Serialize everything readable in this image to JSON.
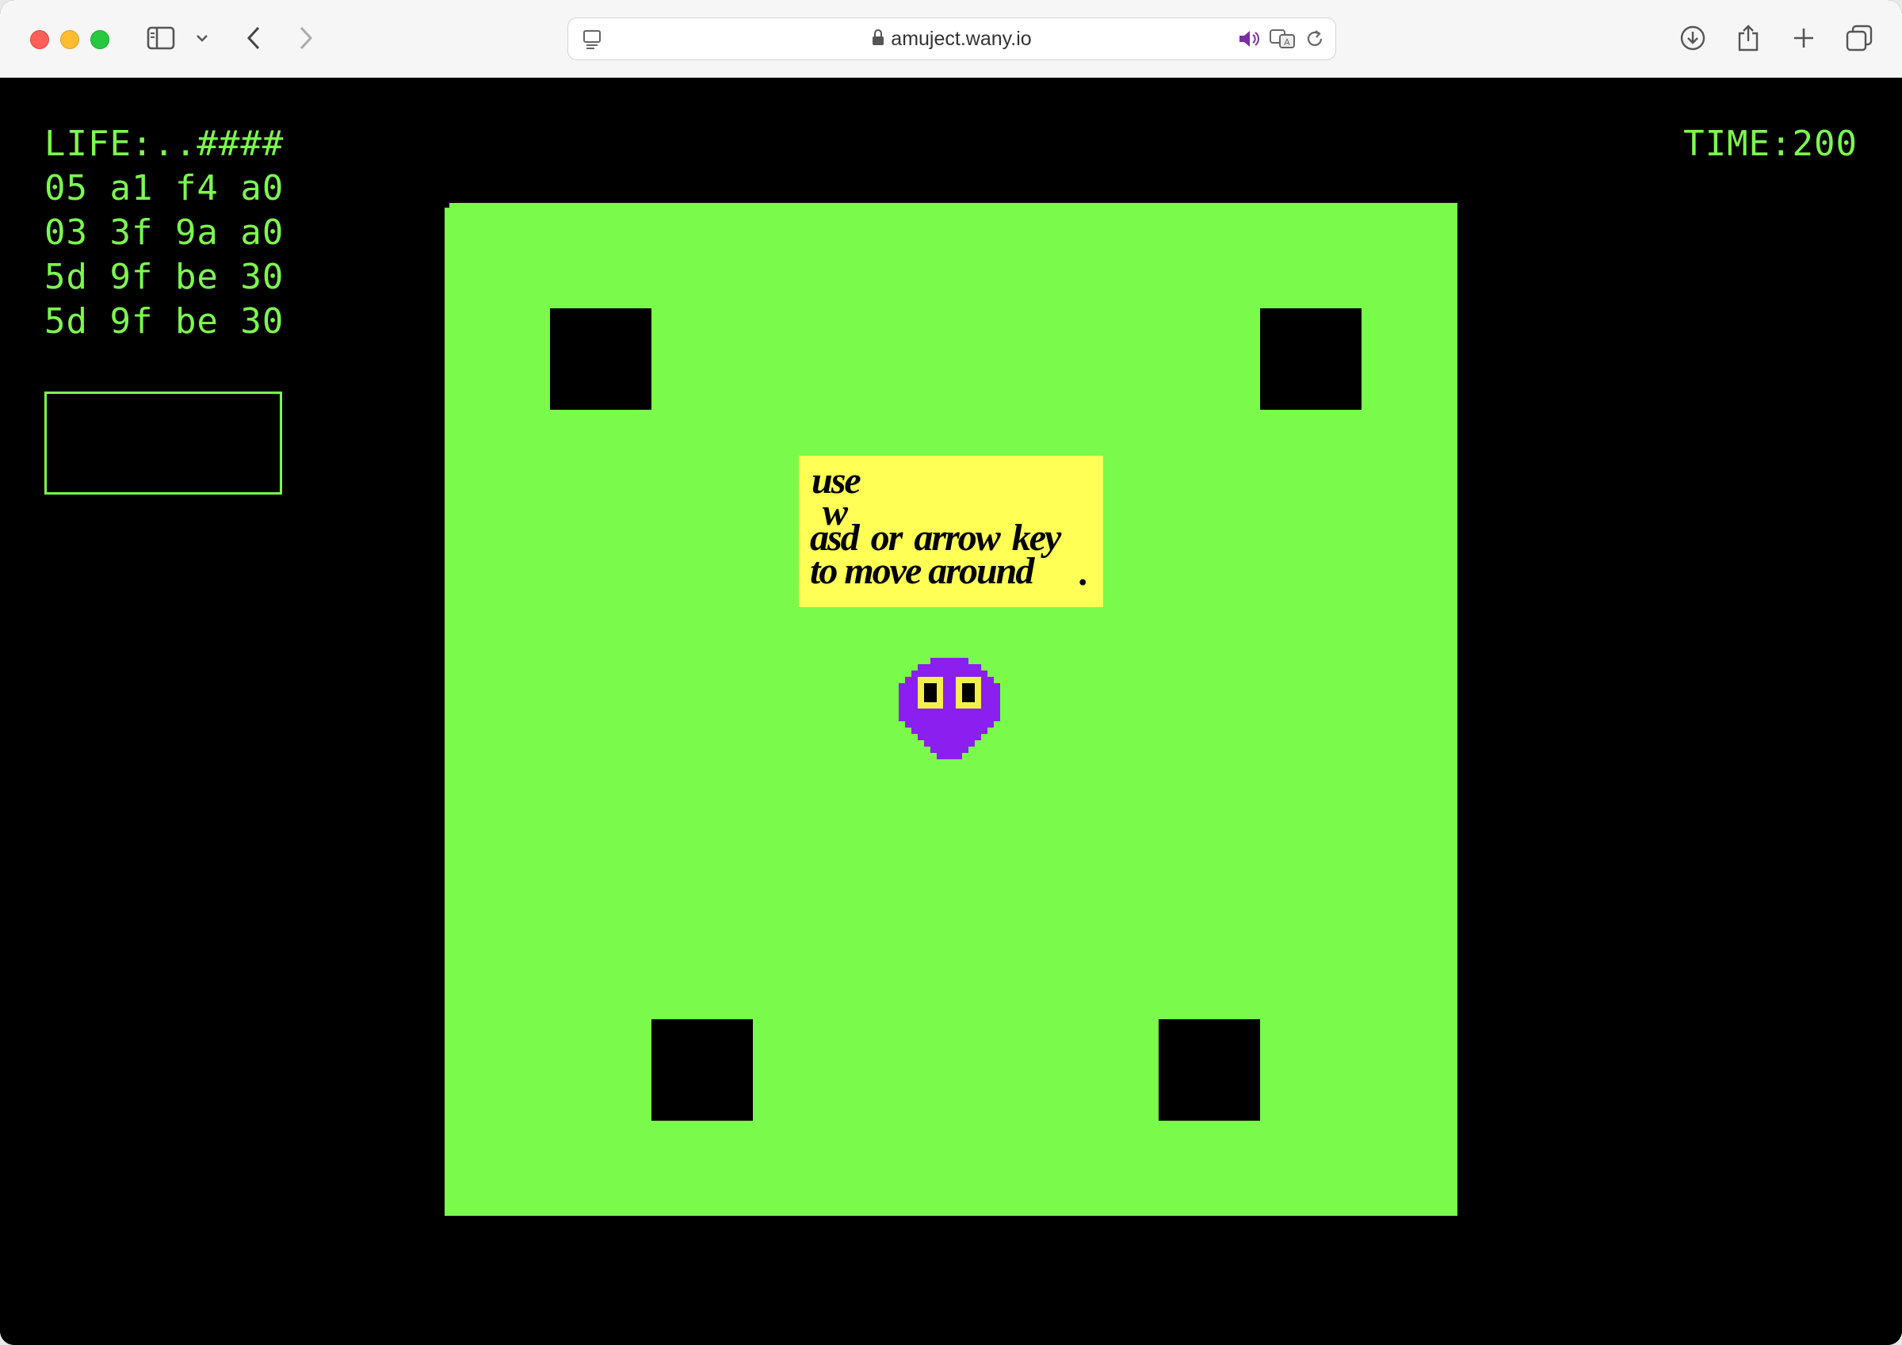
{
  "browser": {
    "url": "amuject.wany.io"
  },
  "hud": {
    "life_label": "LIFE:..####",
    "hex_rows": [
      "05 a1 f4 a0",
      "03 3f 9a a0",
      "5d 9f be 30",
      "5d 9f be 30"
    ],
    "time_label": "TIME:200"
  },
  "hint": {
    "line1": "use",
    "line2": "w",
    "line3": "asd  or  arrow key",
    "line4": "to move around",
    "dot": "."
  },
  "colors": {
    "hud_green": "#7cfc4e",
    "field_green": "#7afa4b",
    "hint_yellow": "#ffff55",
    "player_purple": "#8a1ff0",
    "eye_yellow": "#f4f04a"
  },
  "icons": {
    "sidebar": "sidebar-icon",
    "back": "chevron-left-icon",
    "forward": "chevron-right-icon",
    "download": "download-icon",
    "share": "share-icon",
    "new_tab": "plus-icon",
    "tabs": "tab-overview-icon"
  }
}
